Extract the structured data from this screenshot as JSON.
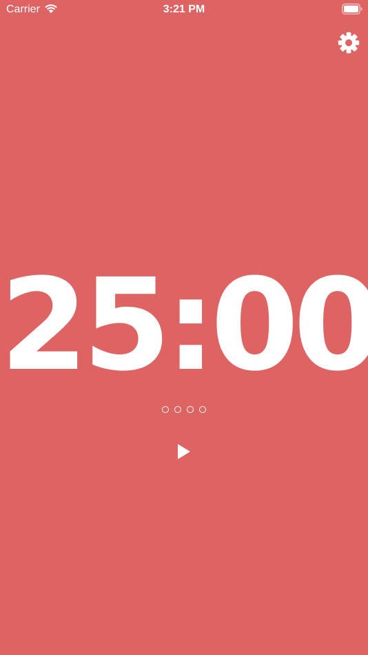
{
  "status_bar": {
    "carrier": "Carrier",
    "time": "3:21 PM",
    "wifi_icon": "wifi-icon",
    "battery_icon": "battery-full-icon"
  },
  "header": {
    "settings_icon": "gear-icon"
  },
  "timer": {
    "display": "25:00"
  },
  "session_progress": {
    "total_sessions": 4,
    "completed_sessions": 0
  },
  "controls": {
    "play_icon": "play-icon"
  },
  "colors": {
    "background": "#DE6363",
    "foreground": "#FFFFFF"
  }
}
